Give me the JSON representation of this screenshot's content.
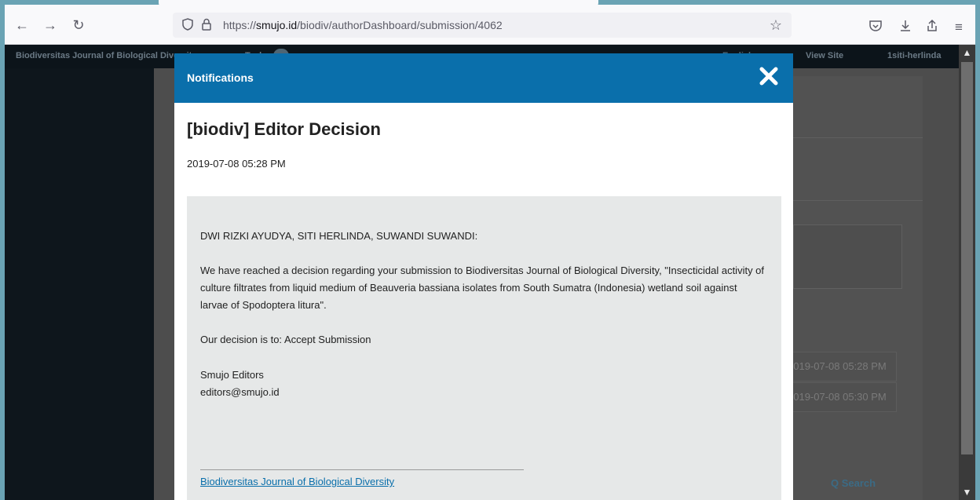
{
  "browser": {
    "url_prefix": "https://",
    "url_host": "smujo.id",
    "url_path": "/biodiv/authorDashboard/submission/4062"
  },
  "page": {
    "site_title": "Biodiversitas Journal of Biological Diversity",
    "tasks_label": "Tasks",
    "language_label": "English",
    "view_site_label": "View Site",
    "user_label": "1siti-herlinda",
    "bg_dates": [
      "2019-07-08 05:28 PM",
      "2019-07-08 05:30 PM"
    ],
    "bg_search_label": "Q Search"
  },
  "modal": {
    "header_title": "Notifications",
    "title": "[biodiv] Editor Decision",
    "date": "2019-07-08 05:28 PM",
    "recipients": "DWI RIZKI AYUDYA, SITI HERLINDA, SUWANDI SUWANDI:",
    "body": "We have reached a decision regarding your submission to Biodiversitas Journal of Biological Diversity, \"Insecticidal activity of culture filtrates from liquid medium of Beauveria bassiana isolates from South Sumatra (Indonesia) wetland soil against larvae of Spodoptera litura\".",
    "decision": "Our decision is to: Accept Submission",
    "signature_name": "Smujo Editors",
    "signature_email": "editors@smujo.id",
    "footer_link": "Biodiversitas Journal of Biological Diversity"
  },
  "colors": {
    "modal_header": "#0a6fab",
    "message_bg": "#e6e8e8",
    "link": "#0a6fab"
  }
}
